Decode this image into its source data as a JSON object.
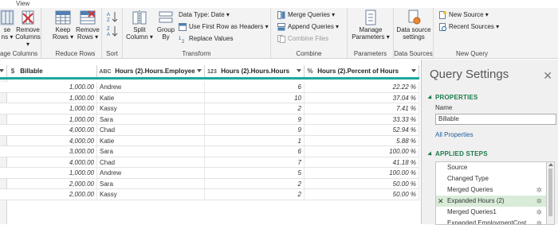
{
  "menu": {
    "view_tab": "View"
  },
  "ribbon": {
    "groups": [
      {
        "label": "age Columns"
      },
      {
        "label": "Reduce Rows"
      },
      {
        "label": "Sort"
      },
      {
        "label": "Transform"
      },
      {
        "label": "Combine"
      },
      {
        "label": "Parameters"
      },
      {
        "label": "Data Sources"
      },
      {
        "label": "New Query"
      }
    ],
    "choose_line1": "se",
    "choose_line2": "ns ▾",
    "remove_line1": "Remove",
    "remove_line2": "Columns ▾",
    "keep_line1": "Keep",
    "keep_line2": "Rows ▾",
    "removerows_line1": "Remove",
    "removerows_line2": "Rows ▾",
    "split_line1": "Split",
    "split_line2": "Column ▾",
    "group_line1": "Group",
    "group_line2": "By",
    "datatype": "Data Type: Date ▾",
    "first_row_headers": "Use First Row as Headers ▾",
    "replace_values": "Replace Values",
    "merge_queries": "Merge Queries ▾",
    "append_queries": "Append Queries ▾",
    "combine_files": "Combine Files",
    "manage_params_line1": "Manage",
    "manage_params_line2": "Parameters ▾",
    "ds_line1": "Data source",
    "ds_line2": "settings",
    "new_source": "New Source ▾",
    "recent_sources": "Recent Sources ▾"
  },
  "table": {
    "columns": [
      {
        "type": "$",
        "name": "Billable"
      },
      {
        "type": "ABC",
        "name": "Hours (2).Hours.Employee"
      },
      {
        "type": "123",
        "name": "Hours (2).Hours.Hours"
      },
      {
        "type": "%",
        "name": "Hours (2).Percent of Hours"
      }
    ],
    "rows": [
      [
        "1,000.00",
        "Andrew",
        "6",
        "22.22 %"
      ],
      [
        "1,000.00",
        "Katie",
        "10",
        "37.04 %"
      ],
      [
        "1,000.00",
        "Kassy",
        "2",
        "7.41 %"
      ],
      [
        "1,000.00",
        "Sara",
        "9",
        "33.33 %"
      ],
      [
        "4,000.00",
        "Chad",
        "9",
        "52.94 %"
      ],
      [
        "4,000.00",
        "Katie",
        "1",
        "5.88 %"
      ],
      [
        "3,000.00",
        "Sara",
        "6",
        "100.00 %"
      ],
      [
        "4,000.00",
        "Chad",
        "7",
        "41.18 %"
      ],
      [
        "1,000.00",
        "Andrew",
        "5",
        "100.00 %"
      ],
      [
        "2,000.00",
        "Sara",
        "2",
        "50.00 %"
      ],
      [
        "2,000.00",
        "Kassy",
        "2",
        "50.00 %"
      ]
    ]
  },
  "query_settings": {
    "title": "Query Settings",
    "close": "✕",
    "properties_heading": "PROPERTIES",
    "name_label": "Name",
    "name_value": "Billable",
    "all_properties": "All Properties",
    "applied_steps_heading": "APPLIED STEPS",
    "steps": [
      {
        "label": "Source",
        "gear": false,
        "selected": false
      },
      {
        "label": "Changed Type",
        "gear": false,
        "selected": false
      },
      {
        "label": "Merged Queries",
        "gear": true,
        "selected": false
      },
      {
        "label": "Expanded Hours (2)",
        "gear": true,
        "selected": true
      },
      {
        "label": "Merged Queries1",
        "gear": true,
        "selected": false
      },
      {
        "label": "Expanded EmploymentCost",
        "gear": true,
        "selected": false
      }
    ]
  },
  "colors": {
    "accent_teal": "#1ca89e",
    "section_green": "#1c7a4a",
    "link_blue": "#1f5e9b",
    "selected_step": "#d8ecd8"
  }
}
